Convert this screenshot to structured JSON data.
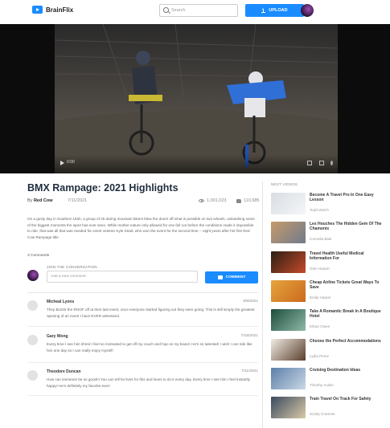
{
  "app": {
    "name": "BrainFlix"
  },
  "header": {
    "search_placeholder": "Search",
    "upload_label": "UPLOAD"
  },
  "video": {
    "current_time": "0:00",
    "title": "BMX Rampage: 2021 Highlights",
    "channel_prefix": "By ",
    "channel": "Red Cow",
    "date": "7/11/2021",
    "views": "1,001,023",
    "likes": "110,985",
    "description": "On a gusty day in Southern Utah, a group of 25 daring mountain bikers blew the doors off what is possible on two wheels, unleashing some of the biggest moments the sport has ever seen. While mother nature only allowed for one full run before the conditions made it impossible to ride, that was all that was needed for event veteran Kyle Strait, who won the event for the second time -- eight years after his first Red Cow Rampage title"
  },
  "comments_section": {
    "count_label": "3 Comments",
    "join_label": "JOIN THE CONVERSATION",
    "input_placeholder": "Add a new comment",
    "button_label": "COMMENT",
    "comments": [
      {
        "author": "Micheal Lyons",
        "date": "8/9/2021",
        "text": "They BLEW the ROOF off at their last event, once everyone started figuring out they were going. This is still simply the greatest opening of an event I have EVER witnessed."
      },
      {
        "author": "Gary Wong",
        "date": "7/15/2021",
        "text": "Every time I see him shred I feel so motivated to get off my couch and hop on my board. He's so talented! I wish I can ride like him one day so I can really enjoy myself!"
      },
      {
        "author": "Theodore Duncan",
        "date": "7/11/2021",
        "text": "How can someone be so good!!! You can tell he lives for this and loves to do it every day. Every time I see him I feel instantly happy! He's definitely my favorite ever!"
      }
    ]
  },
  "sidebar": {
    "heading": "NEXT VIDEOS",
    "items": [
      {
        "title": "Become A Travel Pro In One Easy Lesson",
        "author": "Todd Welch",
        "colors": [
          "#d9dde2",
          "#f4f6f8"
        ]
      },
      {
        "title": "Les Houches The Hidden Gem Of The Chamonix",
        "author": "Cornelia Blair",
        "colors": [
          "#c79a6b",
          "#6f7b8b"
        ]
      },
      {
        "title": "Travel Health Useful Medical Information For",
        "author": "Glen Harper",
        "colors": [
          "#2b1e14",
          "#c44a2a"
        ]
      },
      {
        "title": "Cheap Airline Tickets Great Ways To Save",
        "author": "Emily Harper",
        "colors": [
          "#e7a43d",
          "#c96a1e"
        ]
      },
      {
        "title": "Take A Romantic Break In A Boutique Hotel",
        "author": "Ethan Owen",
        "colors": [
          "#1d4c3a",
          "#8fb9a8"
        ]
      },
      {
        "title": "Choose the Perfect Accommodations",
        "author": "Lydia Perez",
        "colors": [
          "#f1ece4",
          "#5a3f2c"
        ]
      },
      {
        "title": "Cruising Destination Ideas",
        "author": "Timothy Austin",
        "colors": [
          "#5d7fa8",
          "#c9d8e6"
        ]
      },
      {
        "title": "Train Travel On Track For Safety",
        "author": "Scotty Cranmer",
        "colors": [
          "#3a4a5e",
          "#d9c9a8"
        ]
      }
    ]
  }
}
